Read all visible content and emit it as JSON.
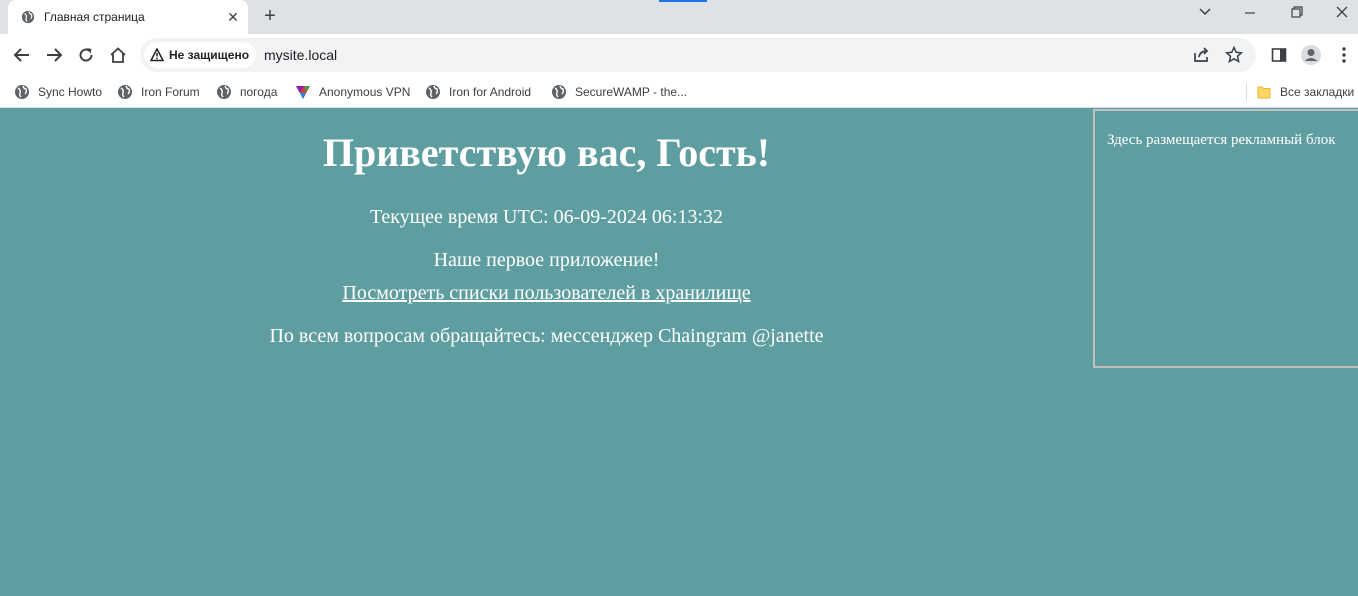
{
  "tab": {
    "title": "Главная страница",
    "favicon": "globe-icon",
    "close_glyph": "✕"
  },
  "tabstrip": {
    "new_tab_glyph": "+",
    "tab_search_glyph": "⌄"
  },
  "toolbar": {
    "security_label": "Не защищено",
    "url": "mysite.local"
  },
  "bookmarks": {
    "items": [
      {
        "label": "Sync Howto",
        "icon": "globe-icon"
      },
      {
        "label": "Iron Forum",
        "icon": "globe-icon"
      },
      {
        "label": "погода",
        "icon": "globe-icon"
      },
      {
        "label": "Anonymous VPN",
        "icon": "vpn-logo-icon"
      },
      {
        "label": "Iron for Android",
        "icon": "globe-icon"
      },
      {
        "label": "SecureWAMP - the...",
        "icon": "globe-icon"
      }
    ],
    "all_bookmarks_label": "Все закладки"
  },
  "page": {
    "greeting": "Приветствую вас, Гость!",
    "time_text": "Текущее время UTC: 06-09-2024 06:13:32",
    "app_text": "Наше первое приложение!",
    "users_link": "Посмотреть списки пользователей в хранилище",
    "contact_text": "По всем вопросам обращайтесь: мессенджер Chaingram @janette",
    "ad_text": "Здесь размещается рекламный блок"
  },
  "colors": {
    "page_background": "#5f9ea0",
    "page_text": "#ffffff",
    "tabstrip_background": "#dee1e6",
    "accent": "#1a73e8"
  }
}
